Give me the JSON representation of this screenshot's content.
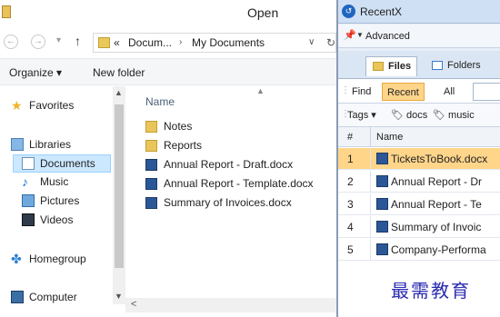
{
  "open_dialog": {
    "title": "Open",
    "address": {
      "overflow": "«",
      "segments": [
        "Docum...",
        "My Documents"
      ],
      "separator": "›"
    },
    "toolbar": {
      "organize": "Organize ▾",
      "new_folder": "New folder"
    },
    "nav": [
      {
        "label": "Favorites",
        "icon": "star-icon"
      },
      {
        "label": "Libraries",
        "icon": "libraries-icon"
      },
      {
        "label": "Documents",
        "icon": "documents-icon",
        "selected": true
      },
      {
        "label": "Music",
        "icon": "music-icon"
      },
      {
        "label": "Pictures",
        "icon": "pictures-icon"
      },
      {
        "label": "Videos",
        "icon": "videos-icon"
      },
      {
        "label": "Homegroup",
        "icon": "homegroup-icon"
      },
      {
        "label": "Computer",
        "icon": "computer-icon"
      }
    ],
    "column_header": "Name",
    "files": [
      {
        "name": "Notes",
        "type": "folder"
      },
      {
        "name": "Reports",
        "type": "folder"
      },
      {
        "name": "Annual Report - Draft.docx",
        "type": "docx"
      },
      {
        "name": "Annual Report - Template.docx",
        "type": "docx"
      },
      {
        "name": "Summary of Invoices.docx",
        "type": "docx"
      }
    ]
  },
  "recentx": {
    "title": "RecentX",
    "advanced": "Advanced",
    "tabs": [
      "Files",
      "Folders"
    ],
    "filters": [
      "Find",
      "Recent",
      "All"
    ],
    "tags": {
      "label": "Tags",
      "items": [
        "docs",
        "music"
      ]
    },
    "columns": {
      "num": "#",
      "name": "Name"
    },
    "rows": [
      {
        "num": "1",
        "name": "TicketsToBook.docx",
        "selected": true
      },
      {
        "num": "2",
        "name": "Annual Report - Dr"
      },
      {
        "num": "3",
        "name": "Annual Report - Te"
      },
      {
        "num": "4",
        "name": "Summary of Invoic"
      },
      {
        "num": "5",
        "name": "Company-Performa"
      }
    ],
    "watermark": "最需教育"
  }
}
